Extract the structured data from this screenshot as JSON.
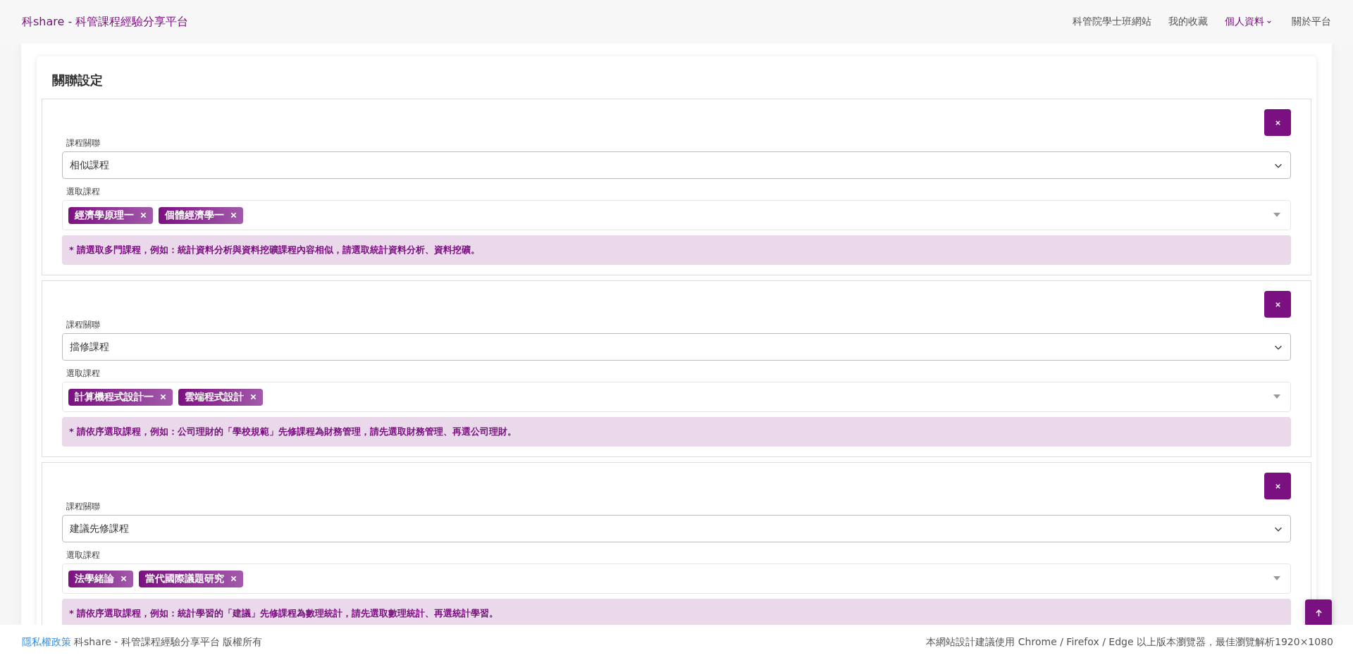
{
  "brand": "科share - 科管課程經驗分享平台",
  "nav": [
    {
      "label": "科管院學士班網站",
      "selected": false,
      "dropdown": false
    },
    {
      "label": "我的收藏",
      "selected": false,
      "dropdown": false
    },
    {
      "label": "個人資料",
      "selected": true,
      "dropdown": true
    },
    {
      "label": "關於平台",
      "selected": false,
      "dropdown": false
    }
  ],
  "card_title": "關聯設定",
  "groups": [
    {
      "relation_label": "課程關聯",
      "relation_value": "相似課程",
      "courses_label": "選取課程",
      "courses": [
        "經濟學原理一",
        "個體經濟學一"
      ],
      "hint": "* 請選取多門課程，例如：統計資料分析與資料挖礦課程內容相似，請選取統計資料分析、資料挖礦。"
    },
    {
      "relation_label": "課程關聯",
      "relation_value": "擋修課程",
      "courses_label": "選取課程",
      "courses": [
        "計算機程式設計一",
        "雲端程式設計"
      ],
      "hint": "* 請依序選取課程，例如：公司理財的「學校規範」先修課程為財務管理，請先選取財務管理、再選公司理財。"
    },
    {
      "relation_label": "課程關聯",
      "relation_value": "建議先修課程",
      "courses_label": "選取課程",
      "courses": [
        "法學緒論",
        "當代國際議題研究"
      ],
      "hint": "* 請依序選取課程，例如：統計學習的「建議」先修課程為數理統計，請先選取數理統計、再選統計學習。"
    }
  ],
  "footer": {
    "privacy_link": "隱私權政策",
    "copyright": "科share - 科管課程經驗分享平台 版權所有",
    "browser_note": "本網站設計建議使用 Chrome / Firefox / Edge 以上版本瀏覽器，最佳瀏覽解析1920×1080"
  }
}
